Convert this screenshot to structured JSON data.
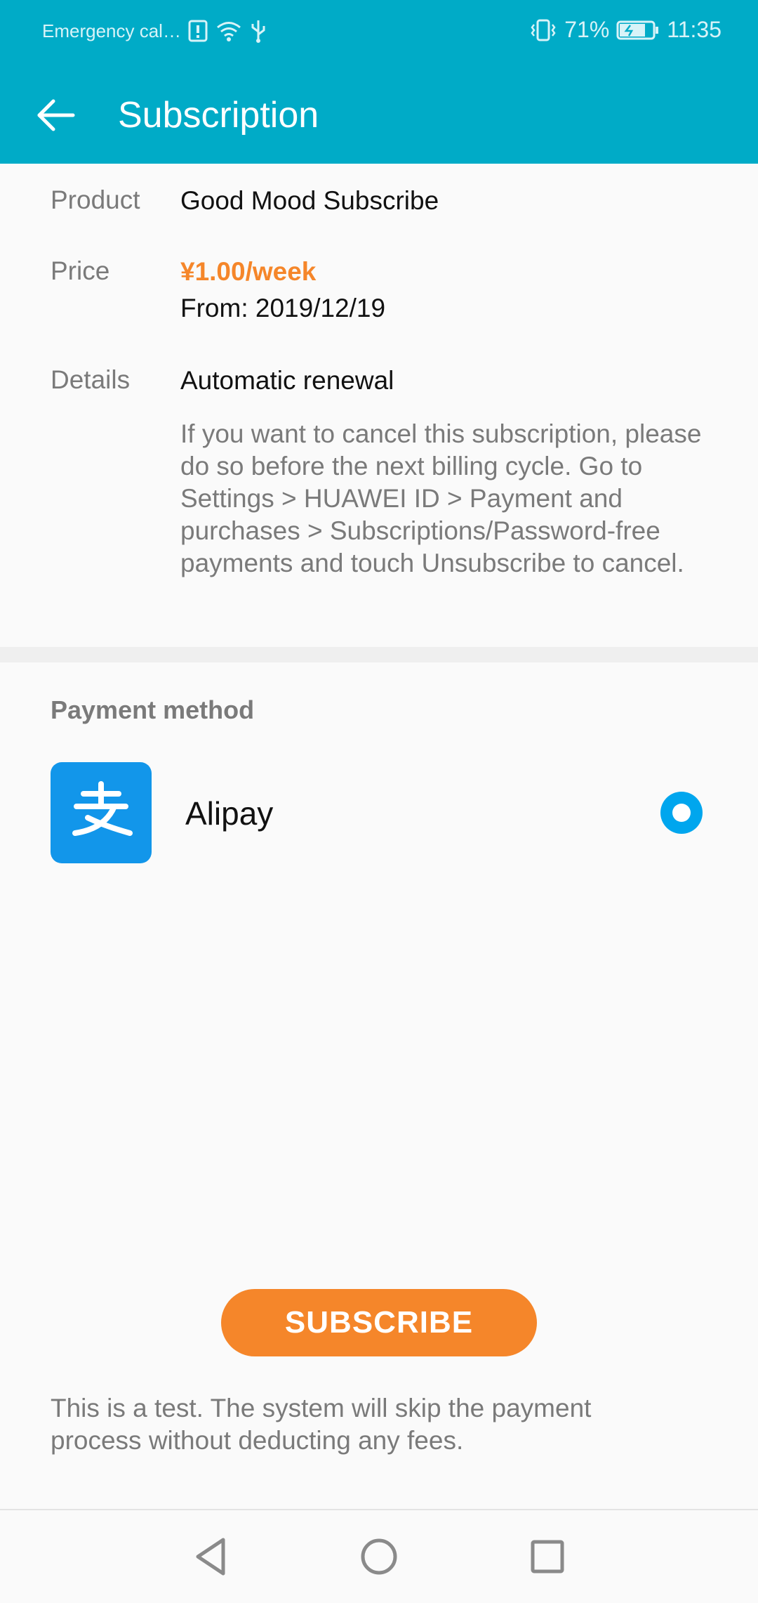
{
  "status_bar": {
    "carrier_text": "Emergency cal…",
    "battery_percent": "71%",
    "time": "11:35",
    "icons": [
      "alert-icon",
      "wifi-icon",
      "usb-icon",
      "vibrate-icon",
      "battery-charging-icon"
    ]
  },
  "toolbar": {
    "title": "Subscription",
    "back_icon": "back-arrow-icon"
  },
  "details": {
    "product_label": "Product",
    "product_value": "Good Mood Subscribe",
    "price_label": "Price",
    "price_value": "¥1.00/week",
    "price_from": "From: 2019/12/19",
    "details_label": "Details",
    "details_value": "Automatic renewal",
    "details_description": "If you want to cancel this subscription, please do so before the next billing cycle. Go to Settings > HUAWEI ID > Payment and purchases > Subscriptions/Password-free payments and touch Unsubscribe to cancel."
  },
  "payment": {
    "section_title": "Payment method",
    "method_name": "Alipay",
    "method_icon": "alipay-icon",
    "selected": true
  },
  "actions": {
    "subscribe_label": "SUBSCRIBE"
  },
  "note": {
    "text": "This is a test. The system will skip the payment process without deducting any fees."
  },
  "nav": {
    "icons": [
      "back-triangle-icon",
      "home-circle-icon",
      "recent-square-icon"
    ]
  },
  "colors": {
    "header": "#00abc7",
    "accent": "#f5862a",
    "radio": "#00a6ee",
    "alipay": "#1296ea"
  }
}
